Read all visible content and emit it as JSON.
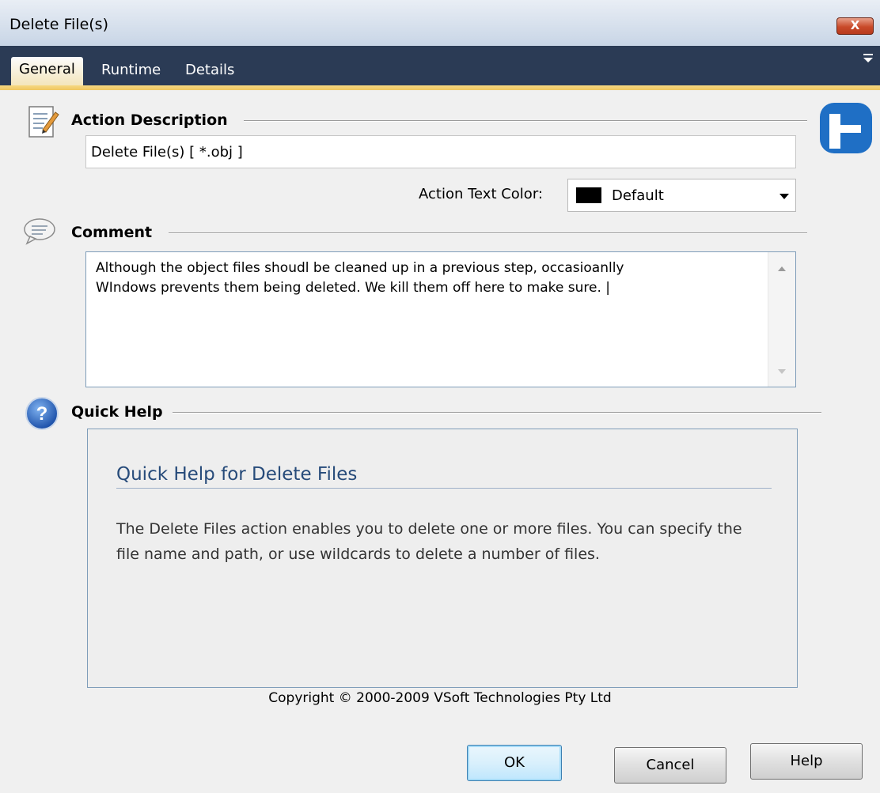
{
  "window": {
    "title": "Delete File(s)",
    "close_label": "X"
  },
  "tabs": [
    {
      "label": "General",
      "active": true
    },
    {
      "label": "Runtime",
      "active": false
    },
    {
      "label": "Details",
      "active": false
    }
  ],
  "action_description": {
    "title": "Action Description",
    "value": "Delete File(s) [ *.obj ]"
  },
  "text_color": {
    "label": "Action Text Color:",
    "value": "Default",
    "swatch": "#000000"
  },
  "comment": {
    "title": "Comment",
    "value": "Although the object files shoudl be cleaned up in a previous step, occasioanlly\nWIndows prevents them being deleted. We kill them off here to make sure. |"
  },
  "quick_help": {
    "title": "Quick Help",
    "heading": "Quick Help for Delete Files",
    "body": "The Delete Files action enables you to delete one or more files. You can specify the file name and path, or use wildcards to delete a number of files."
  },
  "copyright": "Copyright © 2000-2009 VSoft Technologies Pty Ltd",
  "buttons": {
    "ok": "OK",
    "cancel": "Cancel",
    "help": "Help"
  },
  "colors": {
    "accent": "#2b3b55",
    "tab_accent": "#f0c660",
    "help_heading": "#274b7a",
    "logo": "#1f6fc5"
  }
}
